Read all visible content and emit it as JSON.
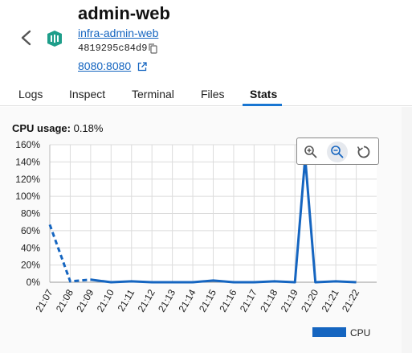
{
  "header": {
    "title": "admin-web",
    "image_link": "infra-admin-web",
    "container_id": "4819295c84d9",
    "port_link": "8080:8080"
  },
  "tabs": [
    {
      "label": "Logs",
      "active": false
    },
    {
      "label": "Inspect",
      "active": false
    },
    {
      "label": "Terminal",
      "active": false
    },
    {
      "label": "Files",
      "active": false
    },
    {
      "label": "Stats",
      "active": true
    }
  ],
  "stats": {
    "cpu_label": "CPU usage:",
    "cpu_value": "0.18%"
  },
  "colors": {
    "accent": "#1976d2",
    "series": "#1565c0",
    "link": "#1565c0"
  },
  "toolbar": {
    "icons": [
      "zoom-in-icon",
      "zoom-out-icon",
      "reset-zoom-icon"
    ]
  },
  "chart_data": {
    "type": "line",
    "x": [
      "21:07",
      "21:08",
      "21:09",
      "21:10",
      "21:11",
      "21:12",
      "21:13",
      "21:14",
      "21:15",
      "21:16",
      "21:17",
      "21:18",
      "21:19",
      "21:19.5",
      "21:20",
      "21:21",
      "21:22"
    ],
    "series": [
      {
        "name": "CPU",
        "values": [
          67,
          1,
          3,
          0,
          1,
          0,
          0,
          0,
          2,
          0,
          0,
          1,
          0,
          145,
          0,
          1,
          0
        ]
      }
    ],
    "y_ticks": [
      "0%",
      "20%",
      "40%",
      "60%",
      "80%",
      "100%",
      "120%",
      "140%",
      "160%"
    ],
    "x_ticks": [
      "21:07",
      "21:08",
      "21:09",
      "21:10",
      "21:11",
      "21:12",
      "21:13",
      "21:14",
      "21:15",
      "21:16",
      "21:17",
      "21:18",
      "21:19",
      "21:20",
      "21:21",
      "21:22"
    ],
    "ylim": [
      0,
      160
    ],
    "grid": true,
    "legend": "bottom-right"
  }
}
